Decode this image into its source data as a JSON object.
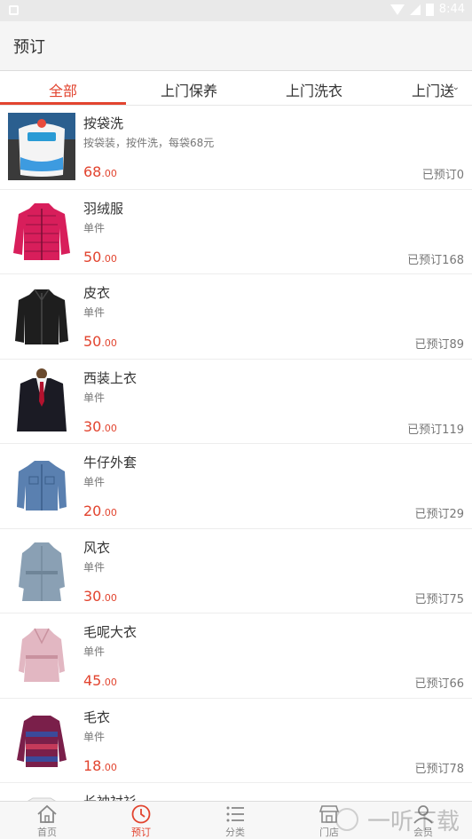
{
  "status_bar": {
    "time": "8:44"
  },
  "app_bar": {
    "title": "预订"
  },
  "tabs": [
    {
      "label": "全部"
    },
    {
      "label": "上门保养"
    },
    {
      "label": "上门洗衣"
    },
    {
      "label": "上门送"
    }
  ],
  "items": [
    {
      "name": "按袋洗",
      "desc": "按袋装，按件洗，每袋68元",
      "price_int": "68",
      "price_dec": ".00",
      "booked": "已预订0",
      "thumb_icon": "laundry-bag-icon"
    },
    {
      "name": "羽绒服",
      "desc": "单件",
      "price_int": "50",
      "price_dec": ".00",
      "booked": "已预订168",
      "thumb_icon": "down-jacket-icon"
    },
    {
      "name": "皮衣",
      "desc": "单件",
      "price_int": "50",
      "price_dec": ".00",
      "booked": "已预订89",
      "thumb_icon": "leather-jacket-icon"
    },
    {
      "name": "西装上衣",
      "desc": "单件",
      "price_int": "30",
      "price_dec": ".00",
      "booked": "已预订119",
      "thumb_icon": "suit-jacket-icon"
    },
    {
      "name": "牛仔外套",
      "desc": "单件",
      "price_int": "20",
      "price_dec": ".00",
      "booked": "已预订29",
      "thumb_icon": "denim-jacket-icon"
    },
    {
      "name": "风衣",
      "desc": "单件",
      "price_int": "30",
      "price_dec": ".00",
      "booked": "已预订75",
      "thumb_icon": "trench-coat-icon"
    },
    {
      "name": "毛呢大衣",
      "desc": "单件",
      "price_int": "45",
      "price_dec": ".00",
      "booked": "已预订66",
      "thumb_icon": "wool-coat-icon"
    },
    {
      "name": "毛衣",
      "desc": "单件",
      "price_int": "18",
      "price_dec": ".00",
      "booked": "已预订78",
      "thumb_icon": "sweater-icon"
    },
    {
      "name": "长袖衬衫",
      "desc": "",
      "price_int": "",
      "price_dec": "",
      "booked": "",
      "thumb_icon": "shirt-icon"
    }
  ],
  "bottom_nav": [
    {
      "label": "首页",
      "icon": "home-icon"
    },
    {
      "label": "预订",
      "icon": "clock-icon"
    },
    {
      "label": "分类",
      "icon": "list-icon"
    },
    {
      "label": "门店",
      "icon": "store-icon"
    },
    {
      "label": "会员",
      "icon": "user-icon"
    }
  ],
  "watermark": {
    "text": "一听下载"
  },
  "colors": {
    "accent": "#e2442f",
    "appbar_bg": "#f5f5f5",
    "status_bar_bg": "#e9e9e9"
  }
}
